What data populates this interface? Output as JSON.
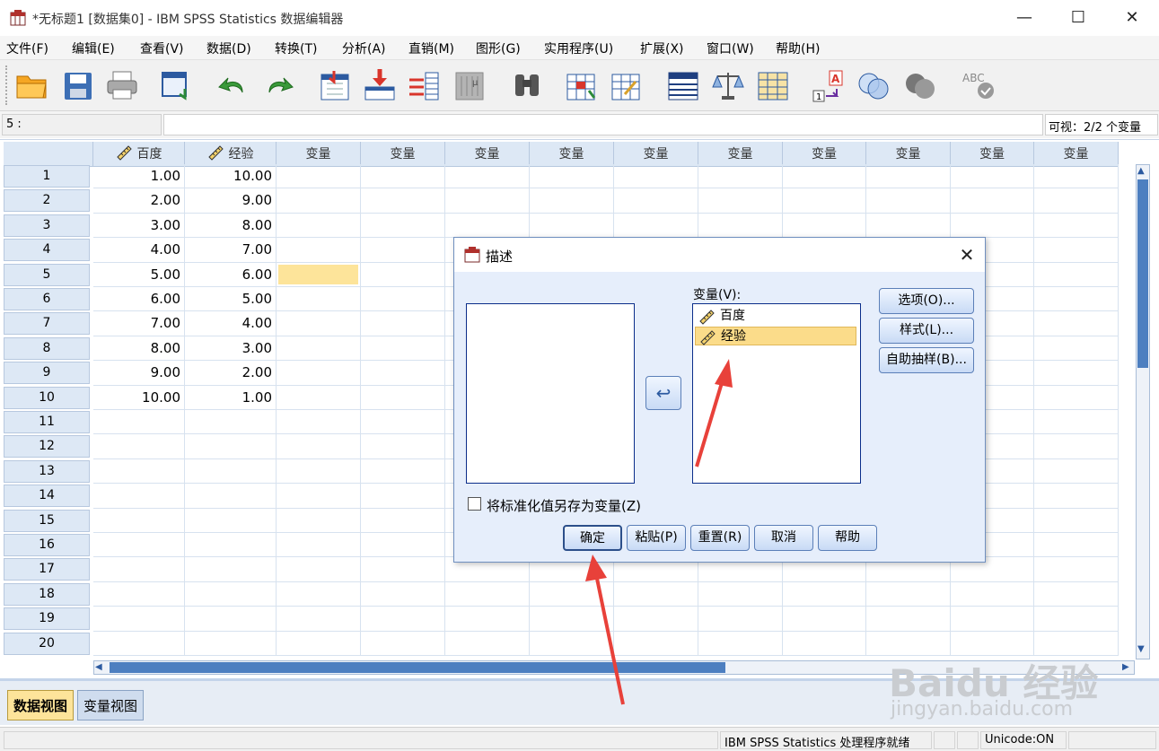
{
  "window": {
    "title": "*无标题1 [数据集0] - IBM SPSS Statistics 数据编辑器",
    "minimize": "—",
    "maximize": "☐",
    "close": "✕"
  },
  "menu": [
    "文件(F)",
    "编辑(E)",
    "查看(V)",
    "数据(D)",
    "转换(T)",
    "分析(A)",
    "直销(M)",
    "图形(G)",
    "实用程序(U)",
    "扩展(X)",
    "窗口(W)",
    "帮助(H)"
  ],
  "toolbar_icons": [
    "open-folder-icon",
    "save-icon",
    "print-icon",
    "recall-dialog-icon",
    "undo-icon",
    "redo-icon",
    "go-to-case-icon",
    "go-to-variable-icon",
    "variables-icon",
    "run-descriptive-icon",
    "find-icon",
    "insert-cases-icon",
    "insert-variable-icon",
    "split-file-icon",
    "weight-cases-icon",
    "select-cases-icon",
    "value-labels-icon",
    "use-sets-icon",
    "show-all-variables-icon",
    "spell-check-icon"
  ],
  "cellbar": {
    "ref": "5 :",
    "visible": "可视：2/2 个变量"
  },
  "grid": {
    "columns": [
      "百度",
      "经验",
      "变量",
      "变量",
      "变量",
      "变量",
      "变量",
      "变量",
      "变量",
      "变量",
      "变量",
      "变量"
    ],
    "row_numbers": [
      "1",
      "2",
      "3",
      "4",
      "5",
      "6",
      "7",
      "8",
      "9",
      "10",
      "11",
      "12",
      "13",
      "14",
      "15",
      "16",
      "17",
      "18",
      "19",
      "20"
    ],
    "data": [
      [
        "1.00",
        "10.00"
      ],
      [
        "2.00",
        "9.00"
      ],
      [
        "3.00",
        "8.00"
      ],
      [
        "4.00",
        "7.00"
      ],
      [
        "5.00",
        "6.00"
      ],
      [
        "6.00",
        "5.00"
      ],
      [
        "7.00",
        "4.00"
      ],
      [
        "8.00",
        "3.00"
      ],
      [
        "9.00",
        "2.00"
      ],
      [
        "10.00",
        "1.00"
      ]
    ],
    "selected_cell": {
      "row": 5,
      "column": 3
    }
  },
  "tabs": {
    "data_view": "数据视图",
    "variable_view": "变量视图"
  },
  "status": {
    "processor": "IBM SPSS Statistics 处理程序就绪",
    "unicode": "Unicode:ON"
  },
  "dialog": {
    "title": "描述",
    "variables_label": "变量(V):",
    "variables": [
      "百度",
      "经验"
    ],
    "selected_variable": "经验",
    "checkbox_label": "将标准化值另存为变量(Z)",
    "side_buttons": [
      "选项(O)...",
      "样式(L)...",
      "自助抽样(B)..."
    ],
    "buttons": [
      "确定",
      "粘贴(P)",
      "重置(R)",
      "取消",
      "帮助"
    ]
  },
  "watermark": {
    "logo": "Baidu 经验",
    "url": "jingyan.baidu.com"
  },
  "colors": {
    "header_bg": "#dde8f5",
    "selected_cell": "#fde49a",
    "selected_item": "#fbdc8a",
    "annotation_arrow": "#e8413a",
    "scroll_thumb": "#4d7fc0"
  }
}
